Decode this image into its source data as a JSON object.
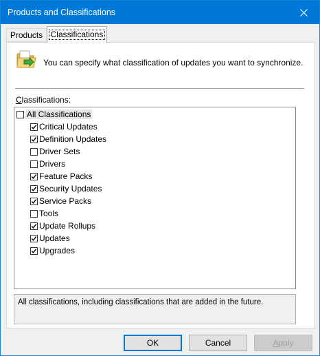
{
  "window": {
    "title": "Products and Classifications",
    "close_glyph": "✕"
  },
  "tabs": [
    {
      "label": "Products",
      "selected": false
    },
    {
      "label": "Classifications",
      "selected": true
    }
  ],
  "intro": {
    "icon": "folder-sync-icon",
    "text": "You can specify what classification of updates you want to synchronize."
  },
  "classifications": {
    "label": "Classifications:",
    "root": {
      "label": "All Classifications",
      "checked": false
    },
    "items": [
      {
        "label": "Critical Updates",
        "checked": true
      },
      {
        "label": "Definition Updates",
        "checked": true
      },
      {
        "label": "Driver Sets",
        "checked": false
      },
      {
        "label": "Drivers",
        "checked": false
      },
      {
        "label": "Feature Packs",
        "checked": true
      },
      {
        "label": "Security Updates",
        "checked": true
      },
      {
        "label": "Service Packs",
        "checked": true
      },
      {
        "label": "Tools",
        "checked": false
      },
      {
        "label": "Update Rollups",
        "checked": true
      },
      {
        "label": "Updates",
        "checked": true
      },
      {
        "label": "Upgrades",
        "checked": true
      }
    ]
  },
  "description": "All classifications, including classifications that are added in the future.",
  "buttons": {
    "ok": "OK",
    "cancel": "Cancel",
    "apply": "Apply"
  },
  "colors": {
    "titlebar": "#0078d7",
    "focus_border": "#0078d7",
    "disabled_text": "#a0a0a0"
  }
}
